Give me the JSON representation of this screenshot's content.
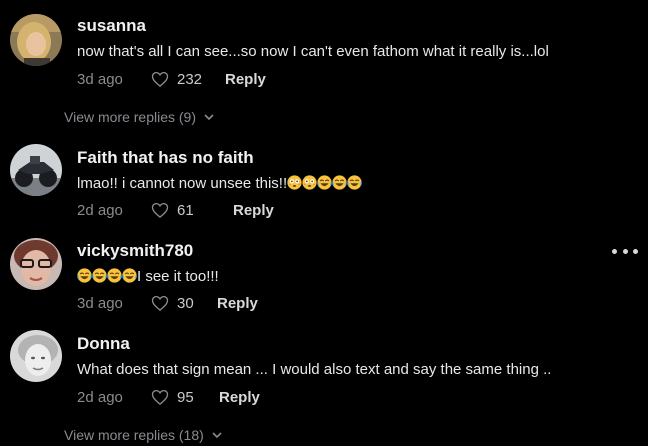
{
  "comments": [
    {
      "username": "susanna",
      "text": "now that's all I can see...so now I can't even fathom what it really is...lol",
      "time": "3d ago",
      "likes": "232",
      "reply_label": "Reply",
      "avatar_icon": "avatar-photo-blonde-woman"
    },
    {
      "username": "Faith that has no faith",
      "text": "lmao!! i cannot now unsee this!!",
      "emojis": [
        "flushed-face-emoji",
        "flushed-face-emoji",
        "tears-of-joy-emoji",
        "tears-of-joy-emoji",
        "tears-of-joy-emoji"
      ],
      "time": "2d ago",
      "likes": "61",
      "reply_label": "Reply",
      "avatar_icon": "avatar-photo-motorcycle"
    },
    {
      "username": "vickysmith780",
      "text": "I see it too!!!",
      "emojis": [
        "tears-of-joy-emoji",
        "tears-of-joy-emoji",
        "tears-of-joy-emoji",
        "tears-of-joy-emoji"
      ],
      "time": "3d ago",
      "likes": "30",
      "reply_label": "Reply",
      "avatar_icon": "avatar-photo-woman-glasses"
    },
    {
      "username": "Donna",
      "text": "What does that sign mean ... I would also text and say the same thing ..",
      "time": "2d ago",
      "likes": "95",
      "reply_label": "Reply",
      "avatar_icon": "avatar-photo-grayscale-woman"
    }
  ],
  "view_more_1": "View more replies (9)",
  "view_more_2": "View more replies (18)",
  "colors": {
    "background": "#000000",
    "username": "#f1f1f2",
    "text": "#e8e8ea",
    "muted": "#8a8b91",
    "emoji_yellow": "#f7c43c"
  }
}
